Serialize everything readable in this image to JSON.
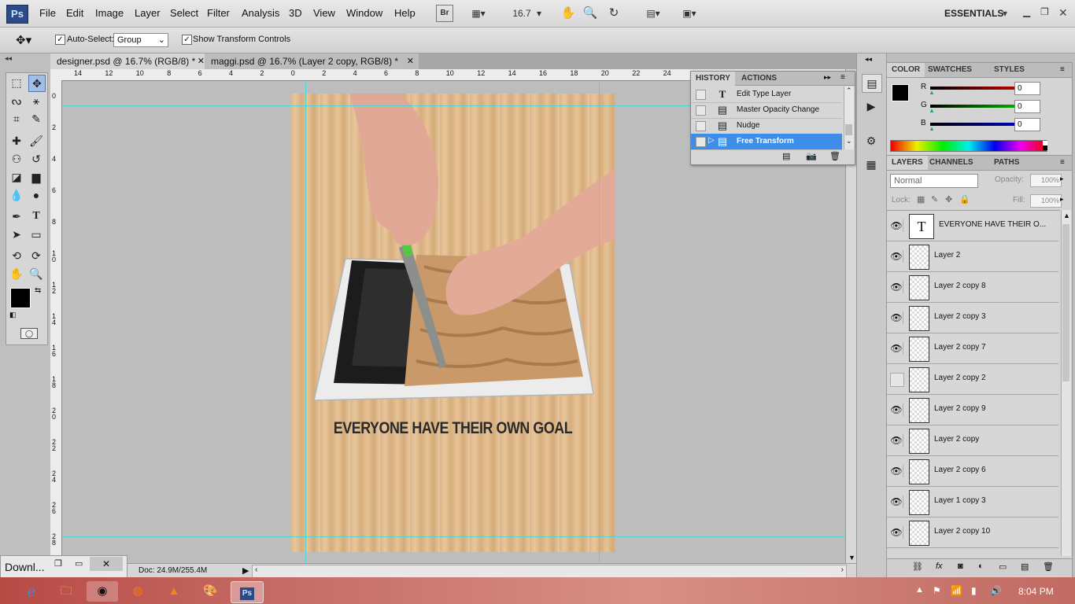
{
  "app": {
    "logo": "Ps"
  },
  "menu": [
    "File",
    "Edit",
    "Image",
    "Layer",
    "Select",
    "Filter",
    "Analysis",
    "3D",
    "View",
    "Window",
    "Help"
  ],
  "appbar": {
    "bridge_label": "Br",
    "zoom": "16.7",
    "workspace": "ESSENTIALS"
  },
  "options": {
    "auto_select_label": "Auto-Select:",
    "auto_select_checked": true,
    "auto_select_value": "Group",
    "show_transform_label": "Show Transform Controls",
    "show_transform_checked": true
  },
  "tabs": [
    {
      "label": "designer.psd @ 16.7% (RGB/8) *",
      "active": true
    },
    {
      "label": "maggi.psd @ 16.7% (Layer 2 copy, RGB/8) *",
      "active": false
    }
  ],
  "rulers": {
    "h": [
      "14",
      "12",
      "10",
      "8",
      "6",
      "4",
      "2",
      "0",
      "2",
      "4",
      "6",
      "8",
      "10",
      "12",
      "14",
      "16",
      "18",
      "20",
      "22",
      "24"
    ],
    "v": [
      "0",
      "2",
      "4",
      "6",
      "8",
      "1 0",
      "1 2",
      "1 4",
      "1 6",
      "1 8",
      "2 0",
      "2 2",
      "2 4",
      "2 6",
      "2 8"
    ]
  },
  "document": {
    "slogan": "EVERYONE HAVE THEIR OWN GOAL"
  },
  "status": {
    "doc_size": "Doc: 24.9M/255.4M"
  },
  "history": {
    "tabs": [
      "HISTORY",
      "ACTIONS"
    ],
    "items": [
      {
        "label": "Edit Type Layer",
        "icon": "type-icon"
      },
      {
        "label": "Master Opacity Change",
        "icon": "history-state-icon"
      },
      {
        "label": "Nudge",
        "icon": "history-state-icon"
      },
      {
        "label": "Free Transform",
        "icon": "history-state-icon",
        "selected": true
      }
    ]
  },
  "color_panel": {
    "tabs": [
      "COLOR",
      "SWATCHES",
      "STYLES"
    ],
    "r_label": "R",
    "g_label": "G",
    "b_label": "B",
    "r": "0",
    "g": "0",
    "b": "0"
  },
  "layers_panel": {
    "tabs": [
      "LAYERS",
      "CHANNELS",
      "PATHS"
    ],
    "blend_mode": "Normal",
    "opacity_label": "Opacity:",
    "opacity": "100%",
    "lock_label": "Lock:",
    "fill_label": "Fill:",
    "fill": "100%",
    "layers": [
      {
        "name": "EVERYONE HAVE THEIR O...",
        "type": "text",
        "visible": true
      },
      {
        "name": "Layer 2",
        "visible": true
      },
      {
        "name": "Layer 2 copy 8",
        "visible": true
      },
      {
        "name": "Layer 2 copy 3",
        "visible": true
      },
      {
        "name": "Layer 2 copy 7",
        "visible": true
      },
      {
        "name": "Layer 2 copy 2",
        "visible": false
      },
      {
        "name": "Layer 2 copy 9",
        "visible": true
      },
      {
        "name": "Layer 2 copy",
        "visible": true
      },
      {
        "name": "Layer 2 copy 6",
        "visible": true
      },
      {
        "name": "Layer 1 copy 3",
        "visible": true
      },
      {
        "name": "Layer 2 copy 10",
        "visible": true
      }
    ]
  },
  "download_bar": {
    "label": "Downl..."
  },
  "taskbar": {
    "time": "8:04 PM"
  },
  "colors": {
    "accent": "#3d8ee8",
    "guide": "#4fd7d7",
    "ps_blue": "#2b4a86"
  }
}
